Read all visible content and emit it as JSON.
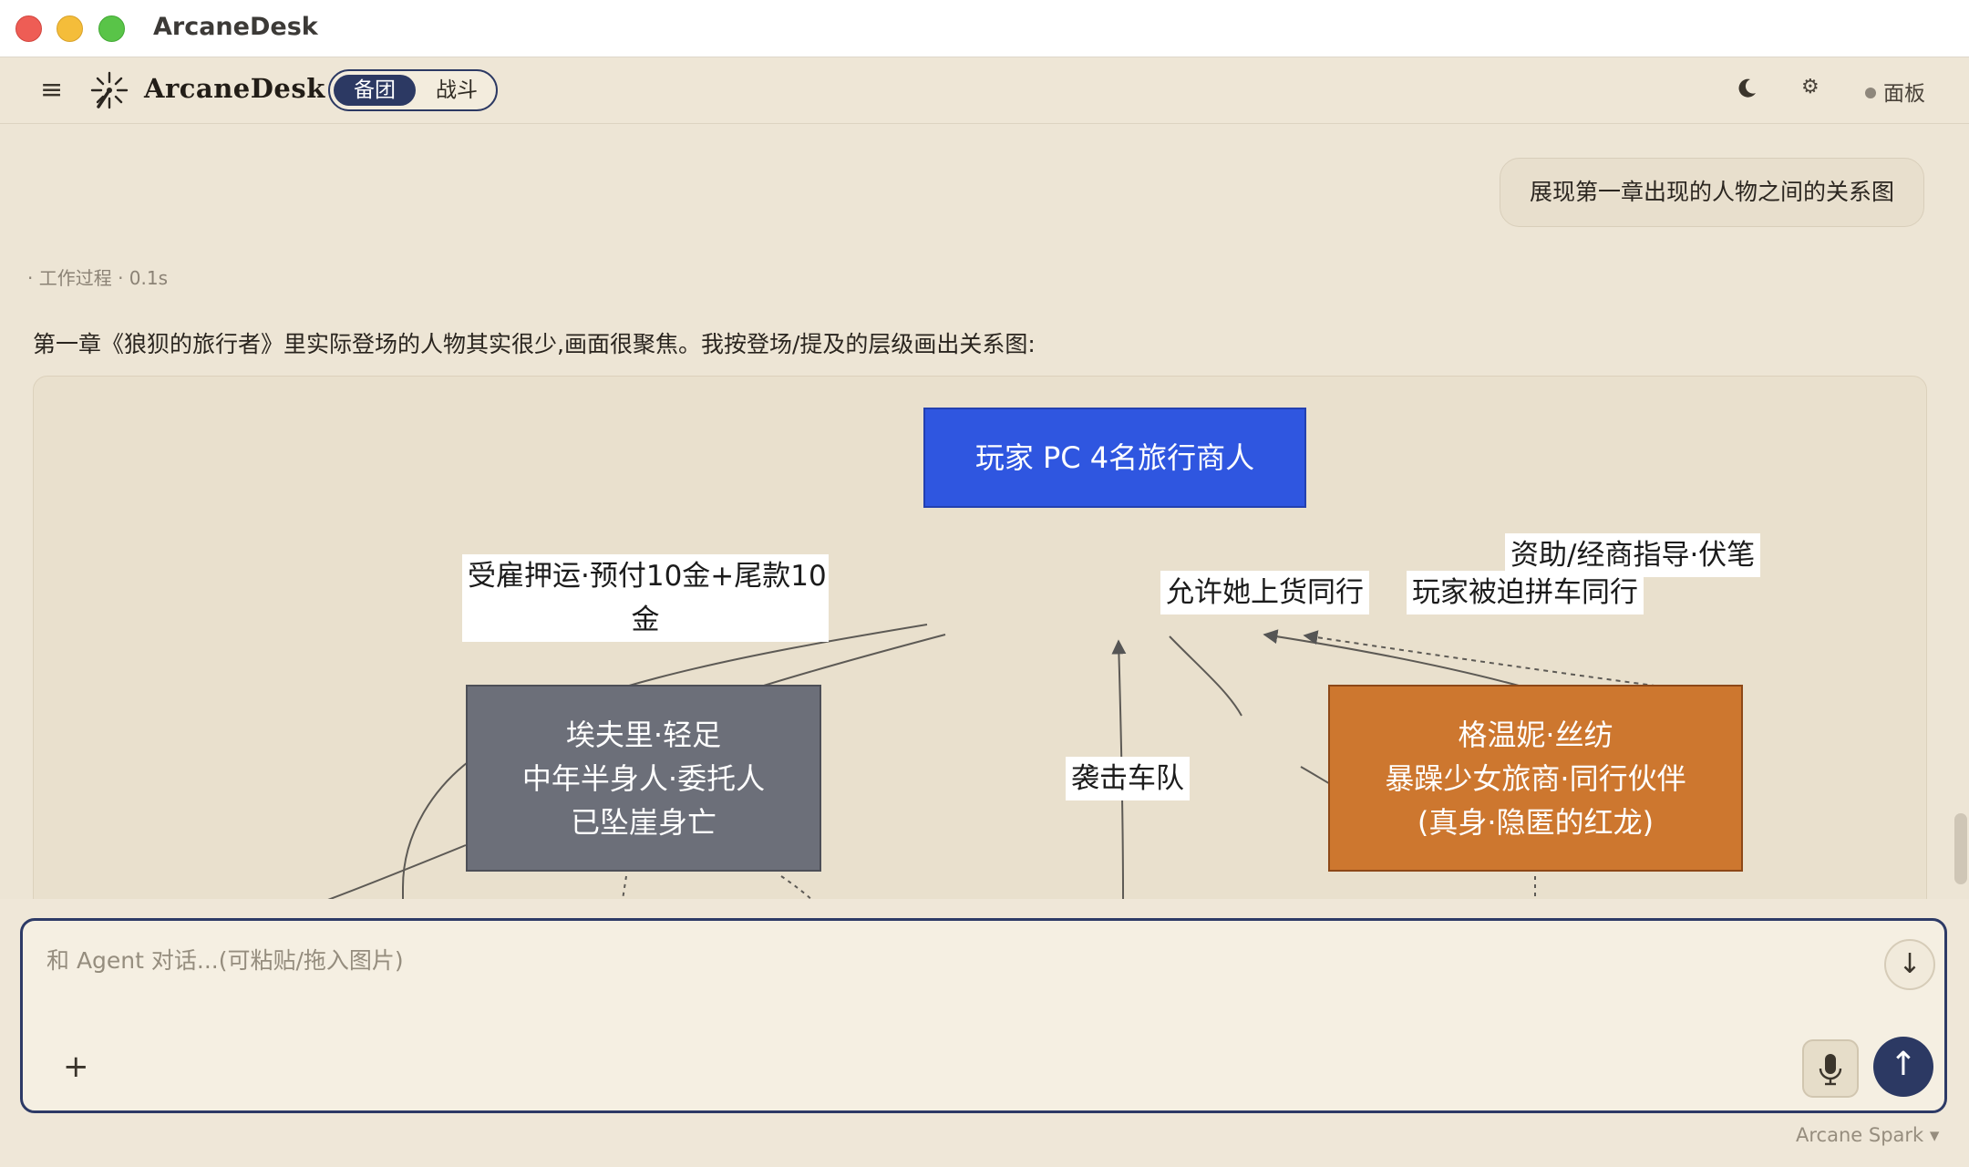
{
  "window": {
    "title": "ArcaneDesk"
  },
  "header": {
    "brand": "ArcaneDesk",
    "modes": {
      "active": "备团",
      "inactive": "战斗"
    },
    "panel_label": "面板",
    "icons": [
      "menu-icon",
      "sparkle-logo-icon",
      "moon-icon",
      "gear-icon"
    ]
  },
  "chat": {
    "user_message": "展现第一章出现的人物之间的关系图",
    "process_label": "· 工作过程 · 0.1s",
    "assistant_text": "第一章《狼狈的旅行者》里实际登场的人物其实很少,画面很聚焦。我按登场/提及的层级画出关系图:",
    "diagram": {
      "nodes": {
        "player": {
          "lines": [
            "玩家 PC 4名旅行商人"
          ],
          "color": "#2f56e0"
        },
        "efuli": {
          "lines": [
            "埃夫里·轻足",
            "中年半身人·委托人",
            "已坠崖身亡"
          ],
          "color": "#6c6f79"
        },
        "gewen": {
          "lines": [
            "格温妮·丝纺",
            "暴躁少女旅商·同行伙伴",
            "(真身·隐匿的红龙)"
          ],
          "color": "#cd772f"
        }
      },
      "edge_labels": {
        "hire": [
          "受雇押运·预付10金+尾款10",
          "金"
        ],
        "allow": "允许她上货同行",
        "forced": "玩家被迫拼车同行",
        "support": "资助/经商指导·伏笔",
        "raid": "袭击车队"
      }
    }
  },
  "composer": {
    "placeholder": "和 Agent 对话...(可粘贴/拖入图片)",
    "plus": "+",
    "scroll_down": "↓",
    "send": "↑",
    "model": "Arcane Spark ▾"
  }
}
